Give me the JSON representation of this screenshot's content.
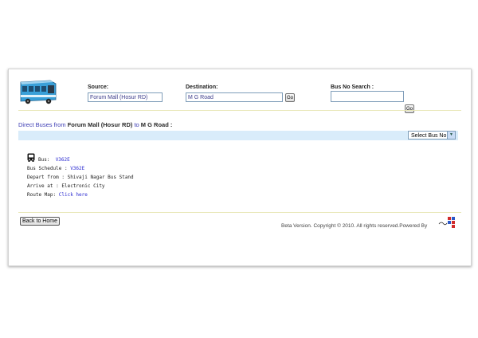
{
  "search": {
    "source_label": "Source:",
    "source_value": "Forum Mall (Hosur RD)",
    "destination_label": "Destination:",
    "destination_value": "M G Road",
    "go_label": "Go",
    "busno_label": "Bus No Search :",
    "busno_value": "",
    "busno_go_label": "Go"
  },
  "results": {
    "prefix": "Direct Buses from ",
    "source": "Forum Mall (Hosur RD)",
    "connector": " to ",
    "destination": "M G Road :",
    "select_value": "Select Bus No"
  },
  "bus": {
    "bus_label": "Bus:",
    "bus_number": "V362E",
    "schedule_label": "Bus Schedule : ",
    "schedule_value": "V362E",
    "depart_label": "Depart from : ",
    "depart_value": "Shivaji Nagar Bus Stand",
    "arrive_label": "Arrive at : ",
    "arrive_value": "Electronic City",
    "route_label": "Route Map: ",
    "route_link": "Click here"
  },
  "footer": {
    "back_button": "Back to Home",
    "copyright": "Beta Version.  Copyright © 2010. All rights reserved.Powered By"
  },
  "colors": {
    "bus_body": "#3aa0d8",
    "link": "#2a2ad0",
    "bar": "#d9ecfa",
    "rule": "#e8e7b8"
  },
  "icons": [
    "bus-image",
    "bus-icon",
    "dropdown-arrow-icon",
    "powered-by-logo"
  ]
}
